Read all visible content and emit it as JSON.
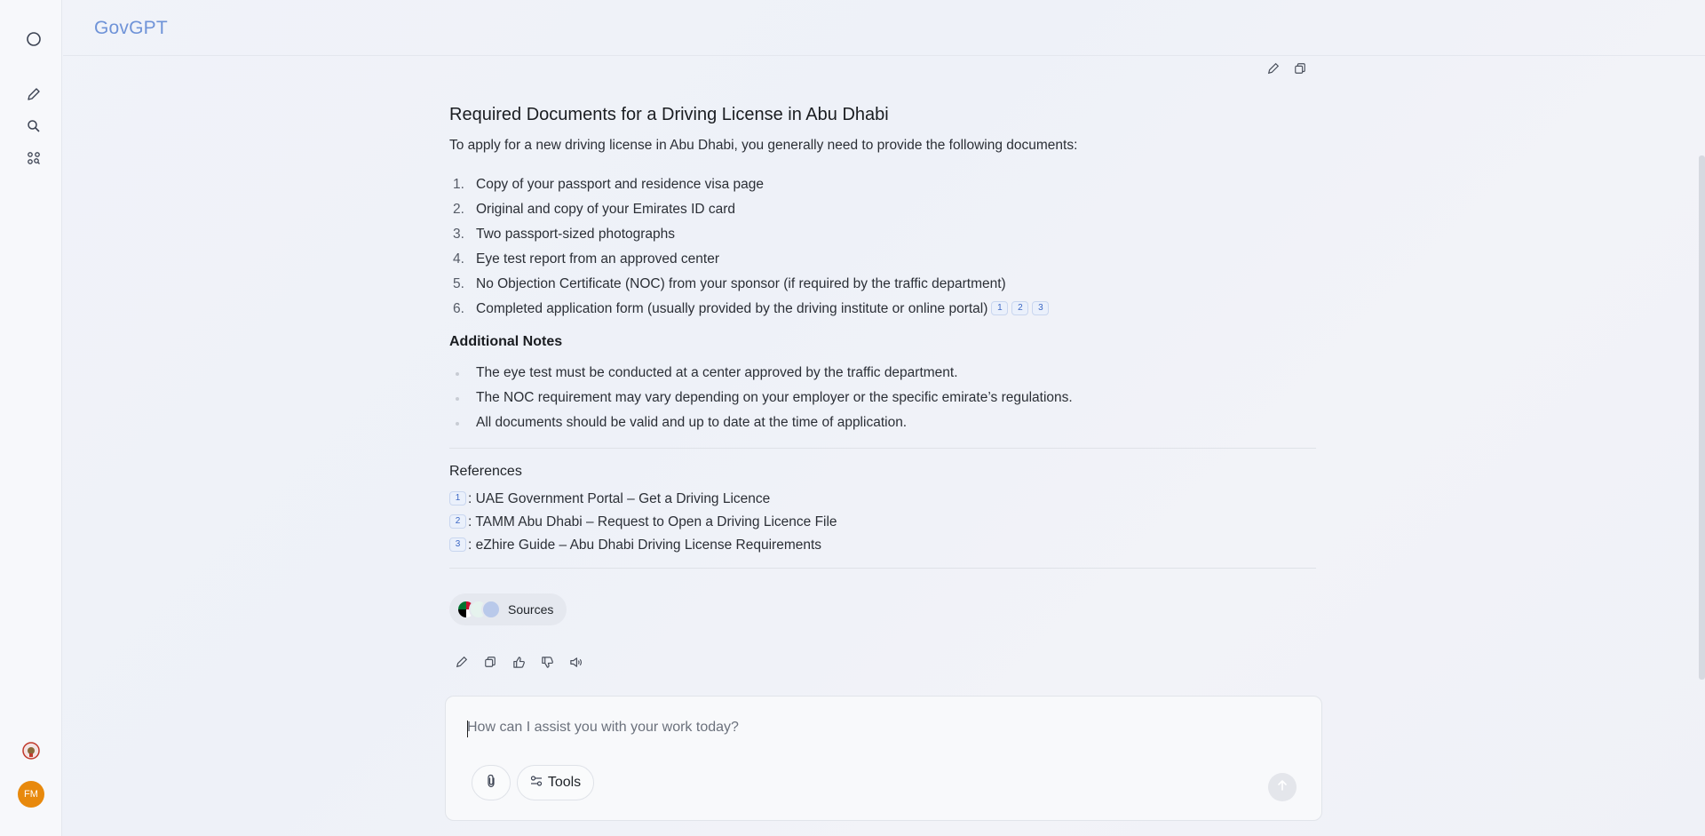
{
  "app": {
    "brand": "GovGPT"
  },
  "rail": {
    "avatar_initials": "FM",
    "items": [
      {
        "icon": "circle-logo-icon"
      },
      {
        "icon": "pencil-icon"
      },
      {
        "icon": "search-icon"
      },
      {
        "icon": "apps-icon"
      }
    ]
  },
  "answer": {
    "title": "Required Documents for a Driving License in Abu Dhabi",
    "intro": "To apply for a new driving license in Abu Dhabi, you generally need to provide the following documents:",
    "documents": [
      {
        "num": "1.",
        "text": "Copy of your passport and residence visa page"
      },
      {
        "num": "2.",
        "text": "Original and copy of your Emirates ID card"
      },
      {
        "num": "3.",
        "text": "Two passport-sized photographs"
      },
      {
        "num": "4.",
        "text": "Eye test report from an approved center"
      },
      {
        "num": "5.",
        "text": "No Objection Certificate (NOC) from your sponsor (if required by the traffic department)"
      },
      {
        "num": "6.",
        "text": "Completed application form (usually provided by the driving institute or online portal)"
      }
    ],
    "citations": [
      "1",
      "2",
      "3"
    ],
    "notes_title": "Additional Notes",
    "notes": [
      "The eye test must be conducted at a center approved by the traffic department.",
      "The NOC requirement may vary depending on your employer or the specific emirate’s regulations.",
      "All documents should be valid and up to date at the time of application."
    ],
    "references_title": "References",
    "references": [
      {
        "num": "1",
        "text": ": UAE Government Portal – Get a Driving Licence"
      },
      {
        "num": "2",
        "text": ": TAMM Abu Dhabi – Request to Open a Driving Licence File"
      },
      {
        "num": "3",
        "text": ": eZhire Guide – Abu Dhabi Driving License Requirements"
      }
    ],
    "sources_label": "Sources"
  },
  "composer": {
    "placeholder": "How can I assist you with your work today?",
    "tools_label": "Tools"
  },
  "colors": {
    "brand": "#6f93d8",
    "avatar": "#e8890c",
    "citation": "#3a66c4"
  }
}
